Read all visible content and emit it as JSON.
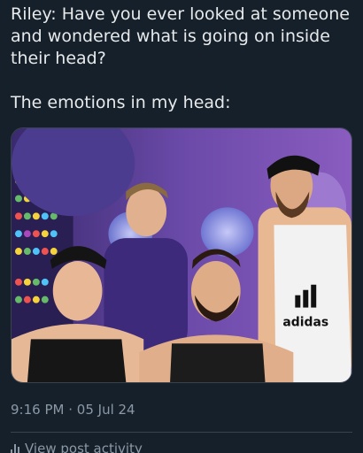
{
  "tweet": {
    "line1": "Riley: Have you ever looked at someone and wondered what is going on inside their head?",
    "line2": "The emotions in my head:"
  },
  "media": {
    "shirt_text": "adidas"
  },
  "meta": {
    "time": "9:16 PM",
    "separator": "·",
    "date": "05 Jul 24"
  },
  "activity": {
    "label": "View post activity",
    "icon": "bar-chart-icon"
  },
  "colors": {
    "background": "#15202b",
    "text": "#e7e9ea",
    "muted": "#8b98a5",
    "border": "#38444d"
  }
}
